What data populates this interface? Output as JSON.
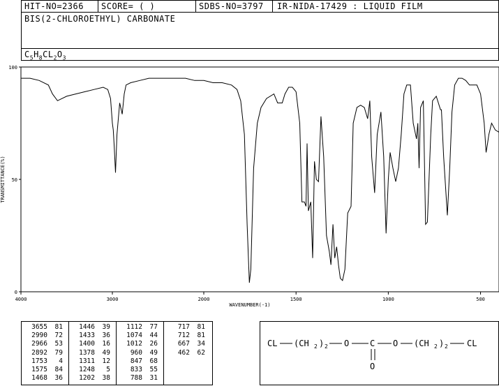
{
  "header": {
    "hit_no": "HIT-NO=2366",
    "score": "SCORE=  (  )",
    "sdbs_no": "SDBS-NO=3797",
    "ir_id": "IR-NIDA-17429 : LIQUID FILM",
    "compound_name": "BIS(2-CHLOROETHYL) CARBONATE",
    "formula_parts": [
      "C",
      "5",
      "H",
      "8",
      "CL",
      "2",
      "O",
      "3"
    ]
  },
  "chart_data": {
    "type": "line",
    "xlabel": "WAVENUMBER(-1)",
    "ylabel": "TRANSMITTANCE(%)",
    "xlim": [
      4000,
      400
    ],
    "ylim": [
      0,
      100
    ],
    "x_ticks": [
      4000,
      3000,
      2000,
      1500,
      1000,
      500
    ],
    "x_tick_labels": [
      "4000",
      "3000",
      "2000",
      "1500",
      "1000",
      "500"
    ],
    "y_ticks": [
      0,
      50,
      100
    ],
    "y_tick_labels": [
      "0",
      "50",
      "100"
    ],
    "series": [
      {
        "x": [
          4000,
          3900,
          3800,
          3700,
          3655,
          3600,
          3500,
          3400,
          3300,
          3200,
          3100,
          3050,
          3020,
          3000,
          2990,
          2980,
          2966,
          2950,
          2920,
          2892,
          2870,
          2850,
          2800,
          2700,
          2600,
          2500,
          2400,
          2300,
          2200,
          2100,
          2000,
          1950,
          1900,
          1850,
          1820,
          1800,
          1780,
          1765,
          1753,
          1745,
          1730,
          1710,
          1690,
          1660,
          1620,
          1600,
          1575,
          1560,
          1540,
          1520,
          1500,
          1480,
          1468,
          1455,
          1446,
          1440,
          1433,
          1420,
          1410,
          1400,
          1390,
          1378,
          1365,
          1350,
          1335,
          1320,
          1311,
          1300,
          1290,
          1280,
          1270,
          1260,
          1248,
          1235,
          1220,
          1202,
          1190,
          1170,
          1150,
          1130,
          1112,
          1100,
          1090,
          1074,
          1060,
          1040,
          1025,
          1012,
          1000,
          990,
          975,
          960,
          945,
          930,
          915,
          900,
          880,
          865,
          847,
          840,
          833,
          825,
          810,
          798,
          788,
          770,
          760,
          740,
          717,
          712,
          700,
          680,
          667,
          655,
          640,
          620,
          600,
          580,
          560,
          540,
          520,
          500,
          480,
          470,
          462,
          455,
          440,
          420,
          400
        ],
        "y": [
          95,
          95,
          94,
          92,
          88,
          85,
          87,
          88,
          89,
          90,
          91,
          90,
          86,
          75,
          72,
          65,
          53,
          70,
          84,
          79,
          88,
          92,
          93,
          94,
          95,
          95,
          95,
          95,
          95,
          94,
          94,
          93,
          93,
          92,
          90,
          85,
          70,
          30,
          4,
          10,
          55,
          75,
          82,
          86,
          88,
          84,
          84,
          88,
          91,
          91,
          89,
          75,
          40,
          40,
          38,
          66,
          36,
          40,
          15,
          58,
          50,
          49,
          78,
          60,
          25,
          18,
          12,
          30,
          15,
          20,
          12,
          6,
          5,
          10,
          35,
          38,
          75,
          82,
          83,
          82,
          77,
          85,
          60,
          44,
          70,
          80,
          60,
          26,
          50,
          62,
          55,
          49,
          55,
          70,
          88,
          92,
          92,
          75,
          68,
          75,
          55,
          82,
          85,
          30,
          31,
          70,
          85,
          87,
          81,
          81,
          60,
          34,
          55,
          80,
          92,
          95,
          95,
          94,
          92,
          92,
          92,
          88,
          75,
          62,
          66,
          70,
          75,
          72,
          71
        ]
      }
    ],
    "peak_table": [
      [
        "3655",
        "81"
      ],
      [
        "2990",
        "72"
      ],
      [
        "2966",
        "53"
      ],
      [
        "2892",
        "79"
      ],
      [
        "1753",
        "4"
      ],
      [
        "1575",
        "84"
      ],
      [
        "1468",
        "36"
      ],
      [
        "1446",
        "39"
      ],
      [
        "1433",
        "36"
      ],
      [
        "1400",
        "16"
      ],
      [
        "1378",
        "49"
      ],
      [
        "1311",
        "12"
      ],
      [
        "1248",
        "5"
      ],
      [
        "1202",
        "38"
      ],
      [
        "1112",
        "77"
      ],
      [
        "1074",
        "44"
      ],
      [
        "1012",
        "26"
      ],
      [
        "960",
        "49"
      ],
      [
        "847",
        "68"
      ],
      [
        "833",
        "55"
      ],
      [
        "788",
        "31"
      ],
      [
        "717",
        "81"
      ],
      [
        "712",
        "81"
      ],
      [
        "667",
        "34"
      ],
      [
        "462",
        "62"
      ]
    ]
  },
  "structure": {
    "left_group": "CL",
    "chain_left": "(CH",
    "sub2_left": "2",
    "close_left": ")",
    "count_left": "2",
    "oxygen_left": "O",
    "carbon": "C",
    "oxygen_right": "O",
    "chain_right": "(CH",
    "sub2_right": "2",
    "close_right": ")",
    "count_right": "2",
    "right_group": "CL",
    "carbonyl_oxygen": "O"
  }
}
